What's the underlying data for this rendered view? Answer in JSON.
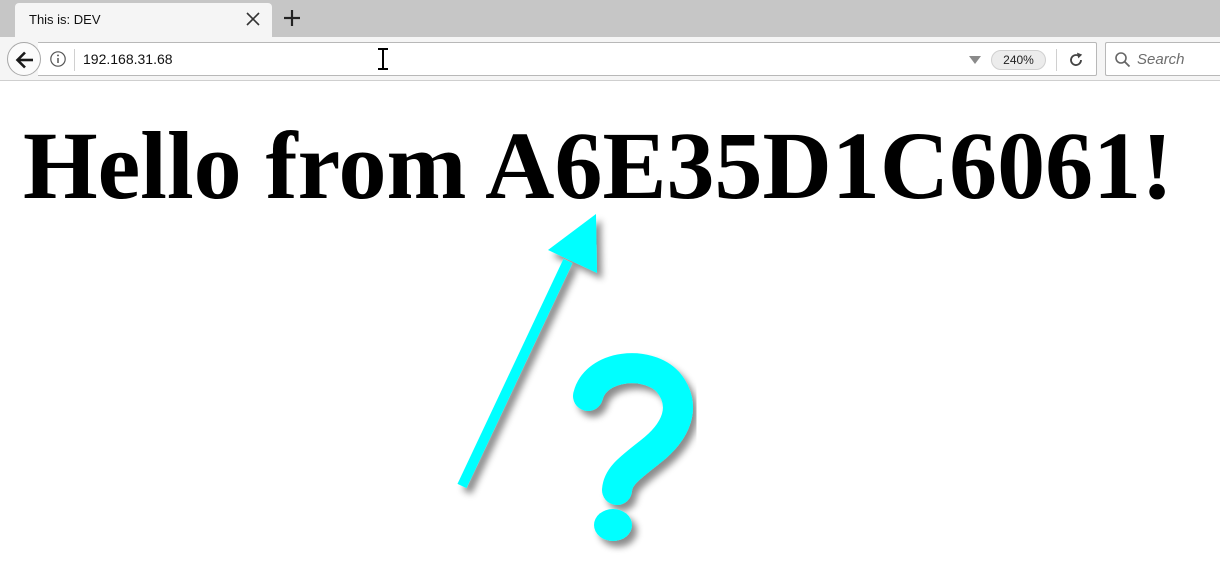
{
  "browser": {
    "tab": {
      "title": "This is: DEV",
      "close_icon": "close-icon"
    },
    "new_tab_icon": "plus-icon",
    "nav": {
      "back_icon": "back-arrow-icon",
      "info_icon": "info-icon",
      "url": "192.168.31.68",
      "dropdown_icon": "chevron-down-icon",
      "zoom": "240%",
      "reload_icon": "reload-icon"
    },
    "search": {
      "icon": "search-icon",
      "placeholder": "Search"
    }
  },
  "page": {
    "heading": "Hello from A6E35D1C6061!",
    "annotation": {
      "color": "#00ffff",
      "arrow_icon": "arrow-icon",
      "question_icon": "question-mark-icon"
    }
  }
}
